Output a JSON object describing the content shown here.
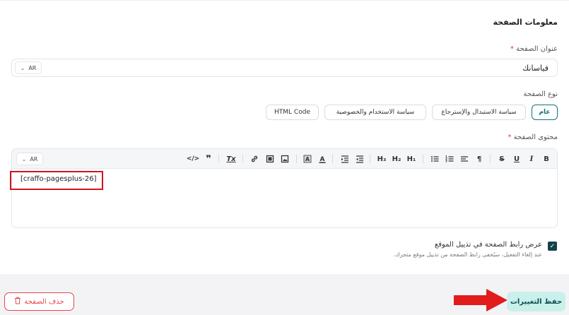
{
  "section": {
    "title": "معلومات الصفحة"
  },
  "page_title": {
    "label": "عنوان الصفحة",
    "required_mark": "*",
    "value": "فياسانك",
    "lang": "AR"
  },
  "page_type": {
    "label": "نوع الصفحة",
    "options": [
      {
        "label": "عام",
        "active": true
      },
      {
        "label": "سياسة الاستبدال والإسترجاع",
        "active": false
      },
      {
        "label": "سياسة الاستخدام والخصوصية",
        "active": false
      },
      {
        "label": "HTML Code",
        "active": false
      }
    ]
  },
  "page_content": {
    "label": "محتوى الصفحة",
    "required_mark": "*",
    "lang": "AR",
    "value": "[craffo-pagesplus-26]",
    "toolbar": {
      "bold": "B",
      "underline": "U",
      "italic": "I",
      "strike": "S",
      "h1": "H₁",
      "h2": "H₂",
      "h3": "H₃",
      "rtl": "¶",
      "quote": "❞",
      "code": "</>",
      "clear": "Tx"
    }
  },
  "footer_link": {
    "label": "عرض رابط الصفحة في تذييل الموقع",
    "help": "عند إلغاء التفعيل، سيُخفى رابط الصفحة من تذييل موقع متجرك.",
    "checked": true
  },
  "actions": {
    "delete_label": "حذف الصفحة",
    "save_label": "حفظ التغييرات"
  }
}
